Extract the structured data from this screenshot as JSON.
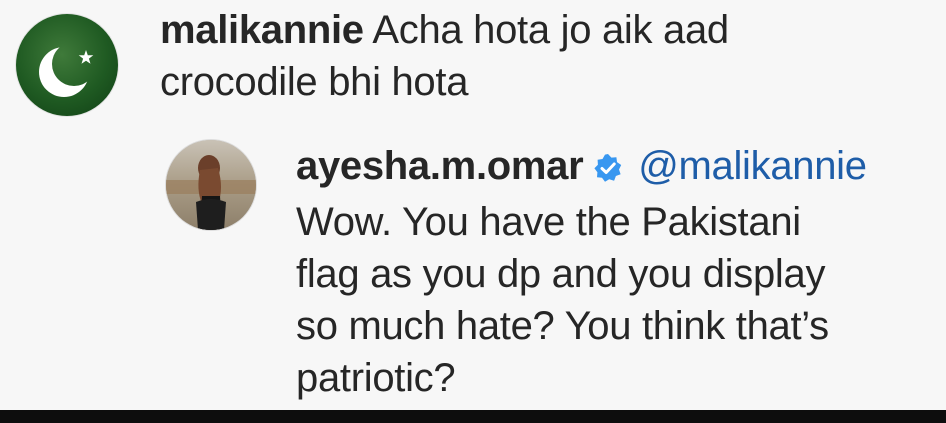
{
  "comments": [
    {
      "username": "malikannie",
      "text_line1": "Acha hota jo aik aad",
      "text_line2": "crocodile bhi hota",
      "avatar_icon": "pakistan-flag-avatar"
    },
    {
      "username": "ayesha.m.omar",
      "verified_icon": "verified-badge-icon",
      "mention": "@malikannie",
      "lines": [
        "Wow. You have the Pakistani",
        "flag as you dp and you display",
        "so much hate? You think that’s",
        "patriotic?"
      ],
      "avatar_icon": "profile-photo-avatar"
    }
  ],
  "colors": {
    "background": "#f7f7f7",
    "text": "#262626",
    "mention": "#1e5da8",
    "verified": "#3897f0",
    "flag_green": "#1f5a22"
  }
}
